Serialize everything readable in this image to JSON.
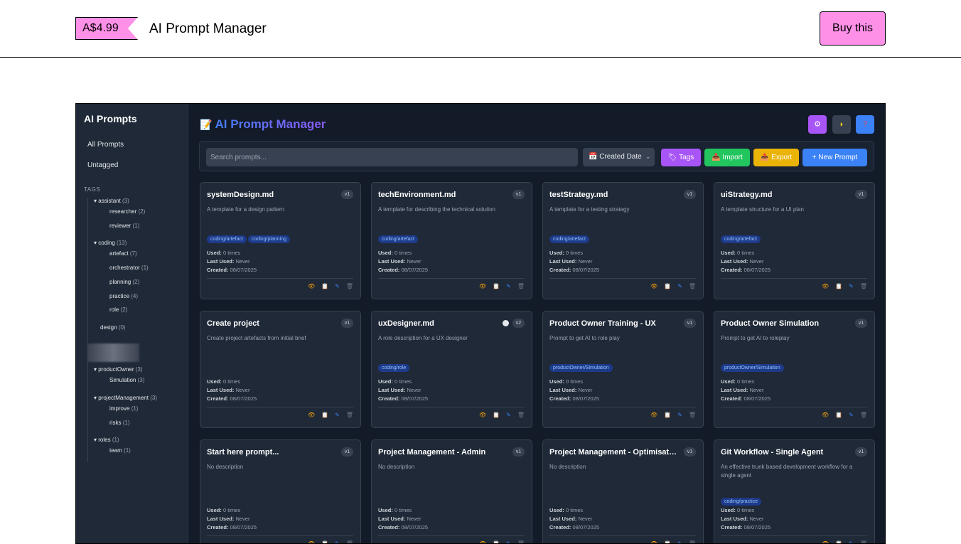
{
  "header": {
    "price": "A$4.99",
    "title": "AI Prompt Manager",
    "buy_label": "Buy this"
  },
  "app": {
    "sidebar": {
      "title": "AI Prompts",
      "all": "All Prompts",
      "untagged": "Untagged",
      "tags_heading": "TAGS",
      "tree": [
        {
          "label": "▾ assistant",
          "count": "(3)",
          "level": 0
        },
        {
          "label": "researcher",
          "count": "(2)",
          "level": 1
        },
        {
          "label": "reviewer",
          "count": "(1)",
          "level": 1
        },
        {
          "label": "▾ coding",
          "count": "(13)",
          "level": 0
        },
        {
          "label": "artefact",
          "count": "(7)",
          "level": 1
        },
        {
          "label": "orchestrator",
          "count": "(1)",
          "level": 1
        },
        {
          "label": "planning",
          "count": "(2)",
          "level": 1
        },
        {
          "label": "practice",
          "count": "(4)",
          "level": 1
        },
        {
          "label": "role",
          "count": "(2)",
          "level": 1
        },
        {
          "label": "design",
          "count": "(0)",
          "level": 0
        },
        {
          "label": "▾ productOwner",
          "count": "(3)",
          "level": 0
        },
        {
          "label": "Simulation",
          "count": "(3)",
          "level": 1
        },
        {
          "label": "▾ projectManagement",
          "count": "(3)",
          "level": 0
        },
        {
          "label": "improve",
          "count": "(1)",
          "level": 1
        },
        {
          "label": "risks",
          "count": "(1)",
          "level": 1
        },
        {
          "label": "▾ roles",
          "count": "(1)",
          "level": 0
        },
        {
          "label": "team",
          "count": "(1)",
          "level": 1
        }
      ]
    },
    "title": "AI Prompt Manager",
    "title_icon": "📝",
    "icons": {
      "settings": "⚙",
      "theme": "◗",
      "help": "?"
    },
    "search_placeholder": "Search prompts...",
    "sort": "📅 Created Date",
    "buttons": {
      "tags": "🏷 Tags",
      "import": "📥 Import",
      "export": "📤 Export",
      "new": "+ New Prompt"
    },
    "colors": {
      "tags": "#a855f7",
      "import": "#22c55e",
      "export": "#eab308",
      "new": "#3b82f6"
    },
    "labels": {
      "used": "Used:",
      "last": "Last Used:",
      "created": "Created:"
    },
    "cards": [
      {
        "title": "systemDesign.md",
        "version": "v1",
        "desc": "A template for a design pattern",
        "tags": [
          "coding/artefact",
          "coding/planning"
        ],
        "used": "0 times",
        "last": "Never",
        "created": "08/07/2025"
      },
      {
        "title": "techEnvironment.md",
        "version": "v1",
        "desc": "A template for describing the technical solution",
        "tags": [
          "coding/artefact"
        ],
        "used": "0 times",
        "last": "Never",
        "created": "08/07/2025"
      },
      {
        "title": "testStrategy.md",
        "version": "v1",
        "desc": "A template for a testing strategy",
        "tags": [
          "coding/artefact"
        ],
        "used": "0 times",
        "last": "Never",
        "created": "08/07/2025"
      },
      {
        "title": "uiStrategy.md",
        "version": "v1",
        "desc": "A template structure for a UI plan",
        "tags": [
          "coding/artefact"
        ],
        "used": "0 times",
        "last": "Never",
        "created": "08/07/2025"
      },
      {
        "title": "Create project",
        "version": "v1",
        "desc": "Create project artefacts from initial brief",
        "tags": [],
        "used": "0 times",
        "last": "Never",
        "created": "08/07/2025"
      },
      {
        "title": "uxDesigner.md",
        "version": "v2",
        "desc": "A role description for a UX designer",
        "tags": [
          "coding/role"
        ],
        "used": "0 times",
        "last": "Never",
        "created": "08/07/2025",
        "dot": true
      },
      {
        "title": "Product Owner Training - UX",
        "version": "v1",
        "desc": "Prompt to get AI to role play",
        "tags": [
          "productOwner/Simulation"
        ],
        "used": "0 times",
        "last": "Never",
        "created": "08/07/2025"
      },
      {
        "title": "Product Owner Simulation",
        "version": "v1",
        "desc": "Prompt to get AI to roleplay",
        "tags": [
          "productOwner/Simulation"
        ],
        "used": "0 times",
        "last": "Never",
        "created": "08/07/2025"
      },
      {
        "title": "Start here prompt...",
        "version": "v1",
        "desc": "No description",
        "tags": [],
        "used": "0 times",
        "last": "Never",
        "created": "08/07/2025"
      },
      {
        "title": "Project Management - Admin",
        "version": "v1",
        "desc": "No description",
        "tags": [],
        "used": "0 times",
        "last": "Never",
        "created": "08/07/2025"
      },
      {
        "title": "Project Management - Optimisati...",
        "version": "v1",
        "desc": "No description",
        "tags": [],
        "used": "0 times",
        "last": "Never",
        "created": "08/07/2025"
      },
      {
        "title": "Git Workflow - Single Agent",
        "version": "v1",
        "desc": "An effective trunk based development workflow for a single agent",
        "tags": [
          "coding/practice"
        ],
        "used": "0 times",
        "last": "Never",
        "created": "08/07/2025"
      }
    ]
  }
}
